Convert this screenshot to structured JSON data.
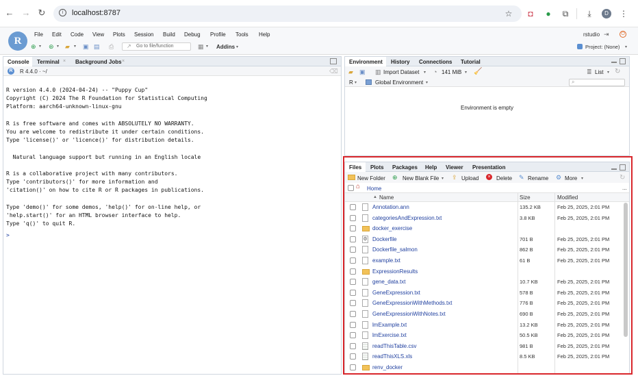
{
  "browser": {
    "url": "localhost:8787",
    "avatar_initial": "D"
  },
  "menu": [
    "File",
    "Edit",
    "Code",
    "View",
    "Plots",
    "Session",
    "Build",
    "Debug",
    "Profile",
    "Tools",
    "Help"
  ],
  "toolbar": {
    "goto_placeholder": "Go to file/function",
    "addins_label": "Addins",
    "user_label": "rstudio",
    "project_label": "Project: (None)"
  },
  "console_pane": {
    "tabs": [
      "Console",
      "Terminal",
      "Background Jobs"
    ],
    "r_version_path": "R 4.4.0 · ~/",
    "output_lines": [
      "R version 4.4.0 (2024-04-24) -- \"Puppy Cup\"",
      "Copyright (C) 2024 The R Foundation for Statistical Computing",
      "Platform: aarch64-unknown-linux-gnu",
      "",
      "R is free software and comes with ABSOLUTELY NO WARRANTY.",
      "You are welcome to redistribute it under certain conditions.",
      "Type 'license()' or 'licence()' for distribution details.",
      "",
      "  Natural language support but running in an English locale",
      "",
      "R is a collaborative project with many contributors.",
      "Type 'contributors()' for more information and",
      "'citation()' on how to cite R or R packages in publications.",
      "",
      "Type 'demo()' for some demos, 'help()' for on-line help, or",
      "'help.start()' for an HTML browser interface to help.",
      "Type 'q()' to quit R."
    ],
    "prompt": ">"
  },
  "environment_pane": {
    "tabs": [
      "Environment",
      "History",
      "Connections",
      "Tutorial"
    ],
    "import_dataset_label": "Import Dataset",
    "memory_label": "141 MiB",
    "list_label": "List",
    "language_label": "R",
    "scope_label": "Global Environment",
    "empty_message": "Environment is empty"
  },
  "files_pane": {
    "tabs": [
      "Files",
      "Plots",
      "Packages",
      "Help",
      "Viewer",
      "Presentation"
    ],
    "actions": {
      "new_folder": "New Folder",
      "new_blank_file": "New Blank File",
      "upload": "Upload",
      "delete": "Delete",
      "rename": "Rename",
      "more": "More"
    },
    "breadcrumb_home": "Home",
    "more_ellipsis": "...",
    "columns": {
      "name": "Name",
      "size": "Size",
      "modified": "Modified"
    },
    "rows": [
      {
        "name": "Annotation.ann",
        "size": "135.2 KB",
        "modified": "Feb 25, 2025, 2:01 PM",
        "kind": "doc"
      },
      {
        "name": "categoriesAndExpression.txt",
        "size": "3.8 KB",
        "modified": "Feb 25, 2025, 2:01 PM",
        "kind": "doc"
      },
      {
        "name": "docker_exercise",
        "size": "",
        "modified": "",
        "kind": "folder"
      },
      {
        "name": "Dockerfile",
        "size": "701 B",
        "modified": "Feb 25, 2025, 2:01 PM",
        "kind": "gear"
      },
      {
        "name": "Dockerfile_salmon",
        "size": "862 B",
        "modified": "Feb 25, 2025, 2:01 PM",
        "kind": "doc"
      },
      {
        "name": "example.txt",
        "size": "61 B",
        "modified": "Feb 25, 2025, 2:01 PM",
        "kind": "doc"
      },
      {
        "name": "ExpressionResults",
        "size": "",
        "modified": "",
        "kind": "folder"
      },
      {
        "name": "gene_data.txt",
        "size": "10.7 KB",
        "modified": "Feb 25, 2025, 2:01 PM",
        "kind": "doc"
      },
      {
        "name": "GeneExpression.txt",
        "size": "578 B",
        "modified": "Feb 25, 2025, 2:01 PM",
        "kind": "doc"
      },
      {
        "name": "GeneExpressionWithMethods.txt",
        "size": "776 B",
        "modified": "Feb 25, 2025, 2:01 PM",
        "kind": "doc"
      },
      {
        "name": "GeneExpressionWithNotes.txt",
        "size": "690 B",
        "modified": "Feb 25, 2025, 2:01 PM",
        "kind": "doc"
      },
      {
        "name": "lmExample.txt",
        "size": "13.2 KB",
        "modified": "Feb 25, 2025, 2:01 PM",
        "kind": "doc"
      },
      {
        "name": "lmExercise.txt",
        "size": "50.5 KB",
        "modified": "Feb 25, 2025, 2:01 PM",
        "kind": "doc"
      },
      {
        "name": "readThisTable.csv",
        "size": "981 B",
        "modified": "Feb 25, 2025, 2:01 PM",
        "kind": "sheet"
      },
      {
        "name": "readThisXLS.xls",
        "size": "8.5 KB",
        "modified": "Feb 25, 2025, 2:01 PM",
        "kind": "sheet"
      },
      {
        "name": "renv_docker",
        "size": "",
        "modified": "",
        "kind": "folder"
      }
    ]
  },
  "colors": {
    "highlight_border": "#d9262b",
    "link_blue": "#1f3f9f",
    "folder_yellow": "#f2c259"
  }
}
